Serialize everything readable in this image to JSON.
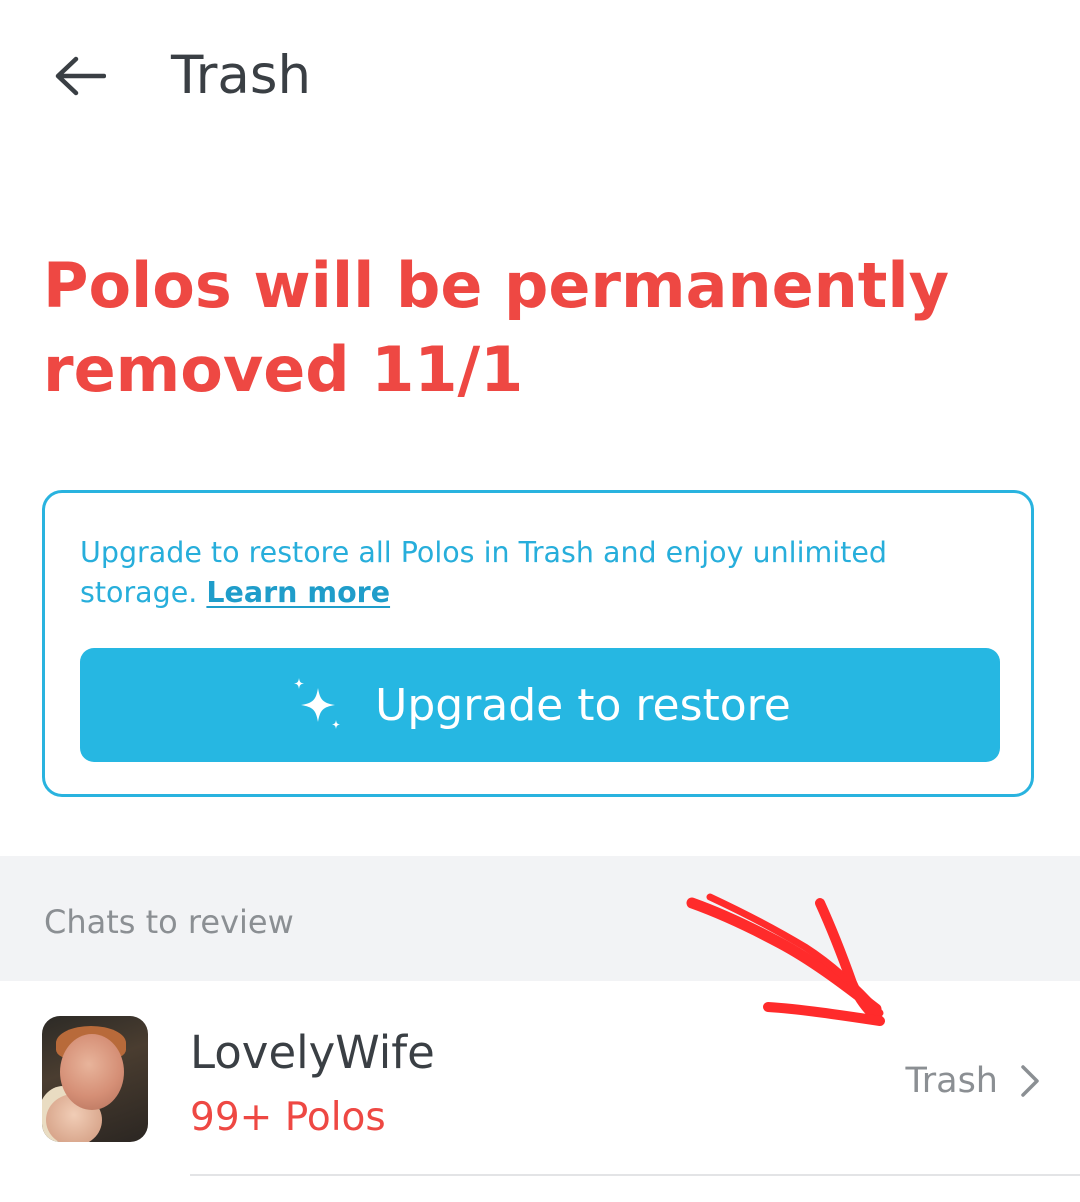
{
  "header": {
    "back_icon": "arrow-left-icon",
    "title": "Trash"
  },
  "warning": {
    "text": "Polos will be permanently removed 11/1",
    "color": "#ee4843"
  },
  "upgrade_card": {
    "description": "Upgrade to restore all Polos in Trash and enjoy unlimited storage.",
    "learn_more_label": "Learn more",
    "button_icon": "sparkle-icon",
    "button_label": "Upgrade to restore",
    "accent_color": "#26b7e2"
  },
  "section": {
    "label": "Chats to review"
  },
  "chats": [
    {
      "name": "LovelyWife",
      "count": "99+ Polos",
      "status": "Trash",
      "chevron_icon": "chevron-right-icon",
      "avatar": "avatar-photo"
    }
  ],
  "annotation": {
    "icon": "red-hand-drawn-arrow",
    "color": "#ff2b2b"
  }
}
